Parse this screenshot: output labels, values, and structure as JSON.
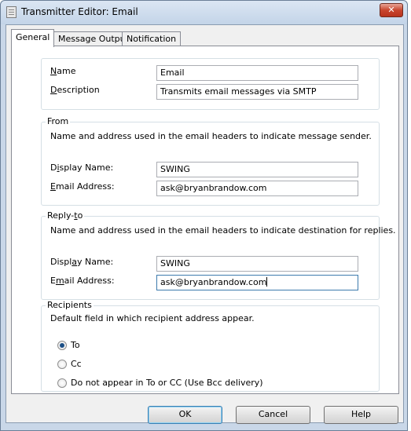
{
  "window": {
    "title": "Transmitter Editor: Email",
    "close_glyph": "✕"
  },
  "tabs": [
    {
      "label": "General",
      "active": true
    },
    {
      "label": "Message Output",
      "active": false
    },
    {
      "label": "Notification",
      "active": false
    }
  ],
  "general": {
    "name_label_u": "N",
    "name_label_rest": "ame",
    "name_value": "Email",
    "description_label_u": "D",
    "description_label_rest": "escription",
    "description_value": "Transmits email messages via SMTP"
  },
  "from": {
    "title": "From",
    "description": "Name and address used in the email headers to indicate message sender.",
    "display_name_label_pre": "D",
    "display_name_label_u": "i",
    "display_name_label_rest": "splay Name:",
    "display_name_value": "SWING",
    "email_label_u": "E",
    "email_label_rest": "mail Address:",
    "email_value": "ask@bryanbrandow.com"
  },
  "reply_to": {
    "title_pre": "Reply-",
    "title_u": "t",
    "title_rest": "o",
    "description": "Name and address used in the email headers to indicate destination for replies.",
    "display_name_label_pre": "Displ",
    "display_name_label_u": "a",
    "display_name_label_rest": "y Name:",
    "display_name_value": "SWING",
    "email_label_pre": "E",
    "email_label_u": "m",
    "email_label_rest": "ail Address:",
    "email_value": "ask@bryanbrandow.com"
  },
  "recipients": {
    "title": "Recipients",
    "description": "Default field in which recipient address appear.",
    "options": [
      {
        "label": "To",
        "checked": true
      },
      {
        "label": "Cc",
        "checked": false
      },
      {
        "label": "Do not appear in To or CC (Use Bcc delivery)",
        "checked": false
      }
    ]
  },
  "buttons": {
    "ok": "OK",
    "cancel": "Cancel",
    "help": "Help"
  }
}
